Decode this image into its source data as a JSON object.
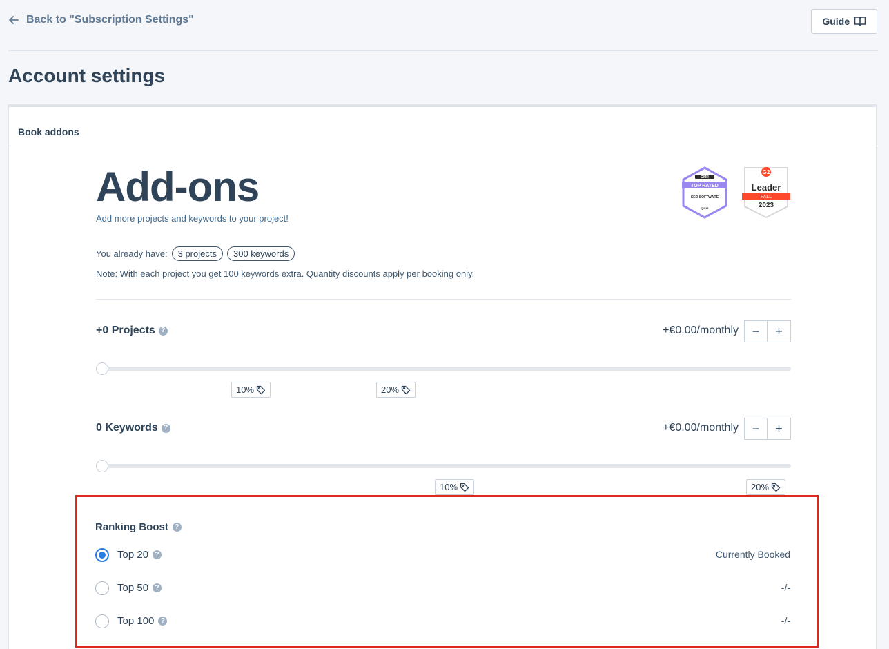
{
  "nav": {
    "back_label": "Back to \"Subscription Settings\"",
    "guide_label": "Guide"
  },
  "page": {
    "title": "Account settings"
  },
  "card": {
    "header": "Book addons"
  },
  "hero": {
    "title": "Add-ons",
    "subtitle": "Add more projects and keywords to your project!"
  },
  "badges": {
    "omr": {
      "brand": "OMR",
      "label": "TOP RATED",
      "category": "SEO SOFTWARE",
      "period": "Q4/23"
    },
    "g2": {
      "brand": "G2",
      "title": "Leader",
      "season": "FALL",
      "year": "2023"
    }
  },
  "current": {
    "prefix": "You already have:",
    "projects": "3 projects",
    "keywords": "300 keywords",
    "note": "Note: With each project you get 100 keywords extra. Quantity discounts apply per booking only."
  },
  "projects": {
    "label": "+0 Projects",
    "price": "+€0.00/monthly",
    "minus": "−",
    "plus": "+",
    "slider_value": 0,
    "discounts": [
      "10%",
      "20%"
    ]
  },
  "keywords": {
    "label": "0 Keywords",
    "price": "+€0.00/monthly",
    "minus": "−",
    "plus": "+",
    "slider_value": 0,
    "discounts": [
      "10%",
      "20%"
    ]
  },
  "ranking_boost": {
    "title": "Ranking Boost",
    "options": [
      {
        "label": "Top 20",
        "status": "Currently Booked",
        "selected": true
      },
      {
        "label": "Top 50",
        "status": "-/-",
        "selected": false
      },
      {
        "label": "Top 100",
        "status": "-/-",
        "selected": false
      }
    ]
  },
  "colors": {
    "accent": "#2a7de1",
    "highlight_border": "#e0291c",
    "text": "#2f4458"
  }
}
